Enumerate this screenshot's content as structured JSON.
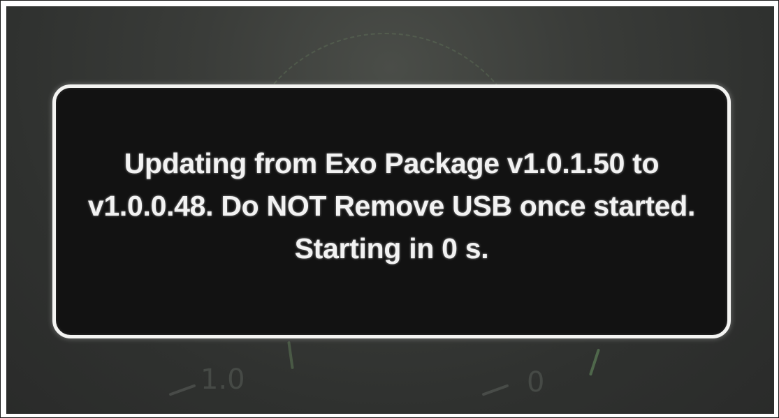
{
  "dialog": {
    "message": "Updating from Exo Package v1.0.1.50 to v1.0.0.48. Do NOT Remove USB once started. Starting in 0 s."
  },
  "gauge": {
    "left_label": "1.0",
    "right_label": "0"
  },
  "colors": {
    "background": "#2f312f",
    "dialog_fill": "#121212",
    "dialog_border": "#f4f4f2",
    "text": "#f2f2f2"
  }
}
